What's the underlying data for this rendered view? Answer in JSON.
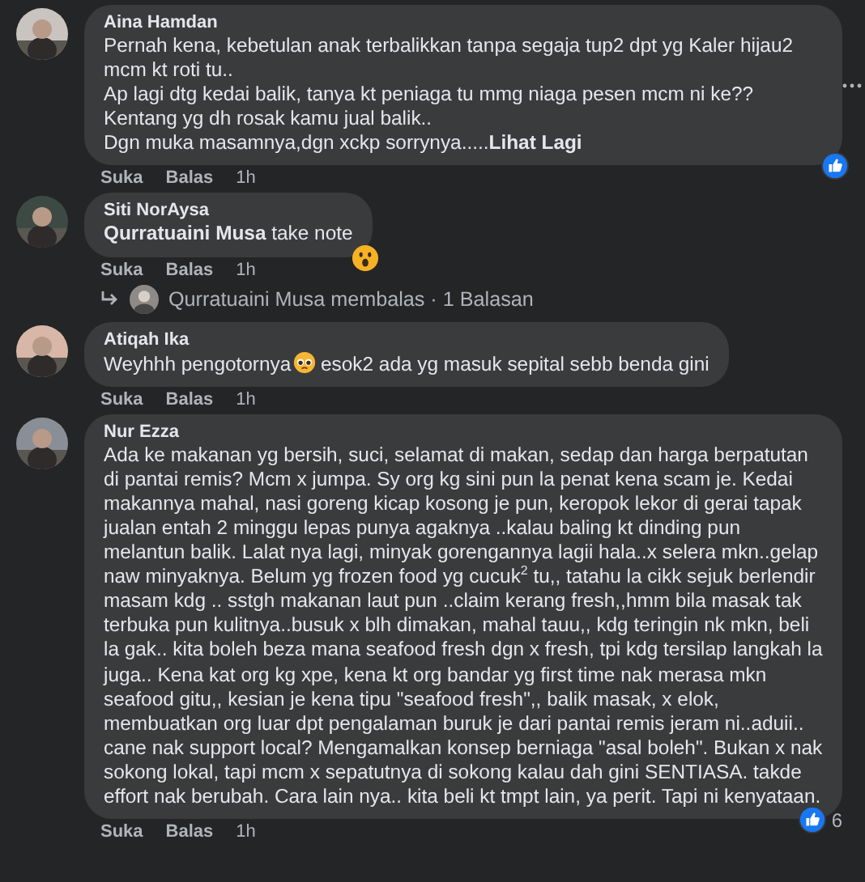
{
  "comments": [
    {
      "author": "Aina Hamdan",
      "text": "Pernah kena, kebetulan anak terbalikkan tanpa segaja tup2 dpt yg Kaler hijau2 mcm kt roti tu..\nAp lagi dtg kedai balik, tanya kt peniaga tu mmg niaga pesen mcm ni ke?? Kentang yg dh rosak kamu jual balik..\nDgn muka masamnya,dgn xckp sorrynya.....",
      "more_link": "Lihat Lagi",
      "actions": [
        "Suka",
        "Balas",
        "1h"
      ],
      "reaction": {
        "kind": "like"
      },
      "menu": true
    },
    {
      "author": "Siti NorAysa",
      "text": "**Qurratuaini Musa** take note",
      "actions": [
        "Suka",
        "Balas",
        "1h"
      ],
      "reaction": {
        "kind": "wow"
      },
      "reply_link": "Qurratuaini Musa membalas · 1 Balasan"
    },
    {
      "author": "Atiqah Ika",
      "text": "Weyhhh pengotornya",
      "text_after": " esok2 ada yg masuk sepital sebb benda gini",
      "actions": [
        "Suka",
        "Balas",
        "1h"
      ]
    },
    {
      "author": "Nur Ezza",
      "text": "Ada ke makanan yg bersih, suci, selamat di makan, sedap dan harga berpatutan di pantai remis? Mcm x jumpa. Sy org kg sini pun la penat kena scam je. Kedai makannya mahal, nasi goreng kicap kosong je pun, keropok lekor di gerai tapak jualan entah 2 minggu lepas punya agaknya ..kalau baling kt dinding pun melantun balik. Lalat nya lagi, minyak gorengannya lagii hala..x selera mkn..gelap naw minyaknya. Belum yg frozen food yg cucuk$^{2}$ tu,, tatahu la cikk sejuk berlendir masam kdg .. sstgh makanan laut pun ..claim kerang fresh,,hmm bila masak tak terbuka pun kulitnya..busuk x blh dimakan, mahal tauu,, kdg teringin nk mkn, beli la gak.. kita boleh beza mana seafood fresh dgn x fresh, tpi kdg tersilap langkah la juga.. Kena kat org kg xpe, kena kt org bandar yg first time nak merasa mkn seafood gitu,, kesian je kena tipu \"seafood fresh\",, balik masak, x elok, membuatkan org luar dpt pengalaman buruk je dari pantai remis jeram ni..aduii.. cane nak support local? Mengamalkan konsep berniaga \"asal boleh\". Bukan x nak sokong lokal, tapi mcm x sepatutnya di sokong kalau dah gini SENTIASA. takde effort nak berubah. Cara lain nya.. kita beli kt tmpt lain, ya perit. Tapi ni kenyataan.",
      "actions": [
        "Suka",
        "Balas",
        "1h"
      ],
      "reaction": {
        "kind": "like",
        "count": "6"
      }
    }
  ]
}
